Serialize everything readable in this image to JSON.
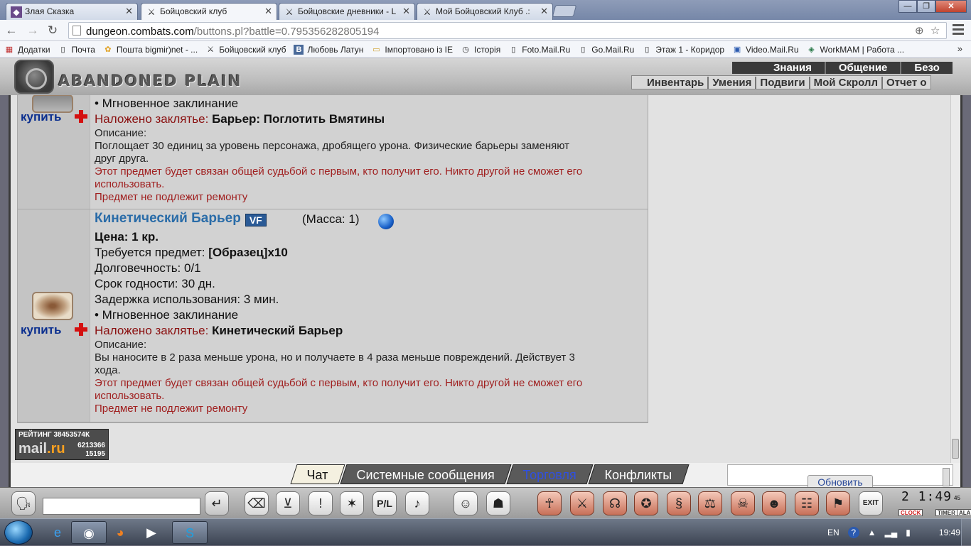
{
  "browser": {
    "tabs": [
      {
        "title": "Злая Сказка",
        "icon": "game-icon"
      },
      {
        "title": "Бойцовский клуб",
        "icon": "swords-icon"
      },
      {
        "title": "Бойцовские дневники - L",
        "icon": "swords-icon"
      },
      {
        "title": "Мой Бойцовский Клуб .:",
        "icon": "swords-icon"
      }
    ],
    "url_host": "dungeon.combats.com",
    "url_rest": "/buttons.pl?battle=0.795356282805194",
    "bookmarks": [
      {
        "label": "Додатки",
        "icon": "apps-icon"
      },
      {
        "label": "Почта",
        "icon": "page-icon"
      },
      {
        "label": "Пошта bigmir)net - ...",
        "icon": "bigmir-icon"
      },
      {
        "label": "Бойцовский клуб",
        "icon": "swords-icon"
      },
      {
        "label": "Любовь Латун",
        "icon": "vk-icon"
      },
      {
        "label": "Імпортовано із IE",
        "icon": "folder-icon"
      },
      {
        "label": "Історія",
        "icon": "history-icon"
      },
      {
        "label": "Foto.Mail.Ru",
        "icon": "page-icon"
      },
      {
        "label": "Go.Mail.Ru",
        "icon": "page-icon"
      },
      {
        "label": "Этаж 1 - Коридор",
        "icon": "page-icon"
      },
      {
        "label": "Video.Mail.Ru",
        "icon": "video-icon"
      },
      {
        "label": "WorkMAM | Работа ...",
        "icon": "workmam-icon"
      }
    ],
    "bookmarks_more": "»"
  },
  "game": {
    "logo_text": "ABANDONED PLAIN",
    "menu_top": [
      "Знания",
      "Общение",
      "Безо"
    ],
    "menu_bottom": [
      "Инвентарь",
      "Умения",
      "Подвиги",
      "Мой Скролл",
      "Отчет о"
    ]
  },
  "items": [
    {
      "buy_label": "купить",
      "lines": [
        {
          "text": "• Мгновенное заклинание",
          "style": "normal"
        }
      ],
      "spell_label": "Наложено заклятье:",
      "spell_value": "Барьер: Поглотить Вмятины",
      "desc_label": "Описание:",
      "desc_text_1": "Поглощает 30 единиц за уровень персонажа, дробящего урона. Физические барьеры заменяют",
      "desc_text_2": "друг друга.",
      "bound_1": "Этот предмет будет связан общей судьбой с первым, кто получит его. Никто другой не сможет его",
      "bound_2": "использовать.",
      "no_repair": "Предмет не подлежит ремонту"
    },
    {
      "buy_label": "купить",
      "name": "Кинетический Барьер",
      "badge": "VF",
      "mass": "(Масса: 1)",
      "price": "Цена: 1 кр.",
      "requires_label": "Требуется предмет:",
      "requires_value": "[Образец]x10",
      "durability": "Долговечность: 0/1",
      "expiry": "Срок годности: 30 дн.",
      "delay": "Задержка использования: 3 мин.",
      "instant": "• Мгновенное заклинание",
      "spell_label": "Наложено заклятье:",
      "spell_value": "Кинетический Барьер",
      "desc_label": "Описание:",
      "desc_text_1": "Вы наносите в 2 раза меньше урона, но и получаете в 4 раза меньше повреждений. Действует 3",
      "desc_text_2": "хода.",
      "bound_1": "Этот предмет будет связан общей судьбой с первым, кто получит его. Никто другой не сможет его",
      "bound_2": "использовать.",
      "no_repair": "Предмет не подлежит ремонту"
    }
  ],
  "counter": {
    "label": "РЕЙТИНГ 38453574К",
    "brand_a": "mail",
    "brand_b": ".ru",
    "n1": "6213366",
    "n2": "15195"
  },
  "chat": {
    "tabs": [
      "Чат",
      "Системные сообщения",
      "Торговля",
      "Конфликты"
    ],
    "refresh_label": "Обновить"
  },
  "clock": {
    "time": "2 1:49",
    "sec": "45",
    "clock_label": "CLOCK",
    "timer_label": "TIMER",
    "alarm_label": "ALA"
  },
  "taskbar": {
    "lang": "EN",
    "time": "19:49"
  }
}
